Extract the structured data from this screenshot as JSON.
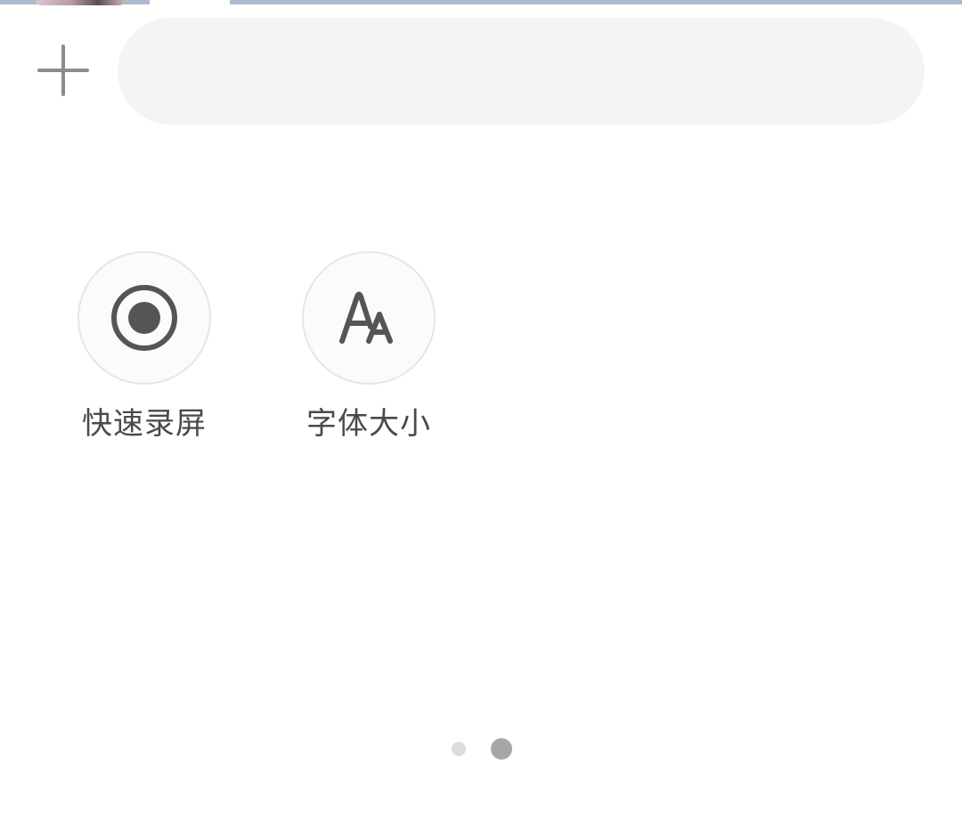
{
  "input": {
    "value": "",
    "placeholder": ""
  },
  "toolbar": {
    "plus_icon": "plus-icon"
  },
  "quick_actions": [
    {
      "label": "快速录屏",
      "icon": "record-icon"
    },
    {
      "label": "字体大小",
      "icon": "font-size-icon"
    }
  ],
  "pager": {
    "pages": 2,
    "current": 2
  },
  "colors": {
    "background": "#ffffff",
    "input_background": "#f4f4f4",
    "icon": "#555555",
    "label": "#4a4a4a",
    "dot_active": "#a6a6a6",
    "dot_inactive": "#dcdcdc"
  }
}
